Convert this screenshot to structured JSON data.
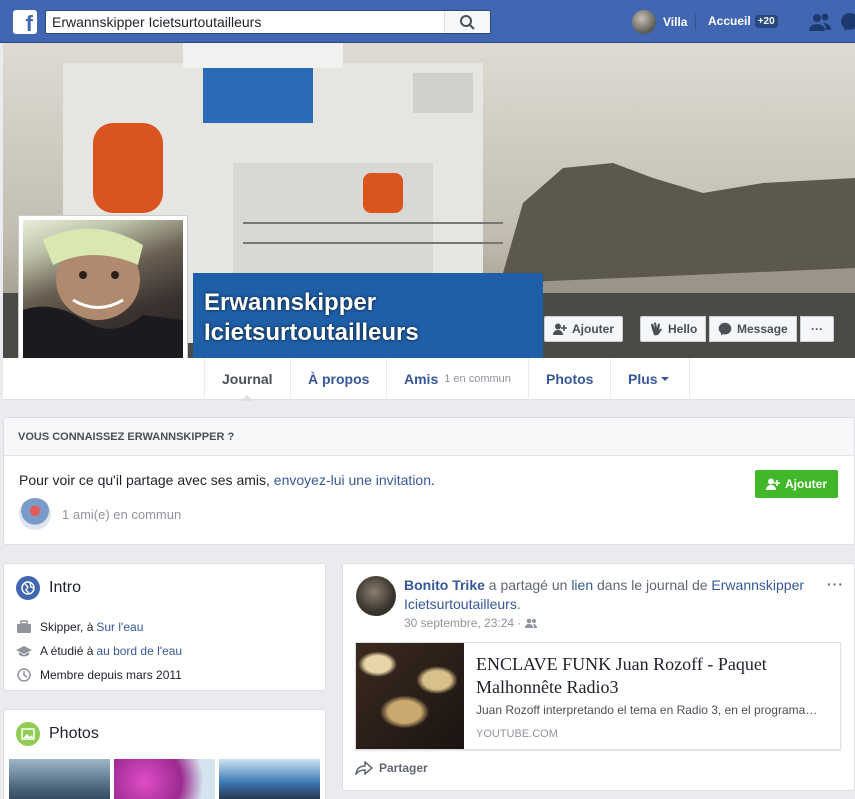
{
  "topbar": {
    "search_value": "Erwannskipper Icietsurtoutailleurs",
    "user_name": "Villa",
    "home_label": "Accueil",
    "home_badge": "+20"
  },
  "profile": {
    "name_line1": "Erwannskipper",
    "name_line2": "Icietsurtoutailleurs",
    "buttons": {
      "add": "Ajouter",
      "hello": "Hello",
      "message": "Message",
      "more": "···"
    }
  },
  "tabs": [
    {
      "label": "Journal"
    },
    {
      "label": "À propos"
    },
    {
      "label": "Amis",
      "sub": "1 en commun"
    },
    {
      "label": "Photos"
    },
    {
      "label": "Plus"
    }
  ],
  "know": {
    "title": "VOUS CONNAISSEZ ERWANNSKIPPER ?",
    "text_before": "Pour voir ce qu'il partage avec ses amis, ",
    "text_link": "envoyez-lui une invitation",
    "text_after": ".",
    "add_button": "Ajouter",
    "mutual": "1 ami(e) en commun"
  },
  "intro": {
    "title": "Intro",
    "work_prefix": "Skipper, à ",
    "work_link": "Sur l'eau",
    "study_prefix": "A étudié à ",
    "study_link": "au bord de l'eau",
    "member_since": "Membre depuis mars 2011"
  },
  "photos": {
    "title": "Photos"
  },
  "post": {
    "author": "Bonito Trike",
    "text1": " a partagé un ",
    "text_link": "lien",
    "text2": " dans le journal de ",
    "target": "Erwannskipper Icietsurtoutailleurs",
    "text3": ".",
    "date": "30 septembre, 23:24 · ",
    "more": "···",
    "share_title": "ENCLAVE FUNK Juan Rozoff - Paquet Malhonnête Radio3",
    "share_desc": "Juan Rozoff interpretando el tema en Radio 3, en el programa…",
    "share_source": "YOUTUBE.COM",
    "share_action": "Partager"
  },
  "colors": {
    "brand": "#4267b2",
    "link": "#365899",
    "green": "#42b72a"
  }
}
